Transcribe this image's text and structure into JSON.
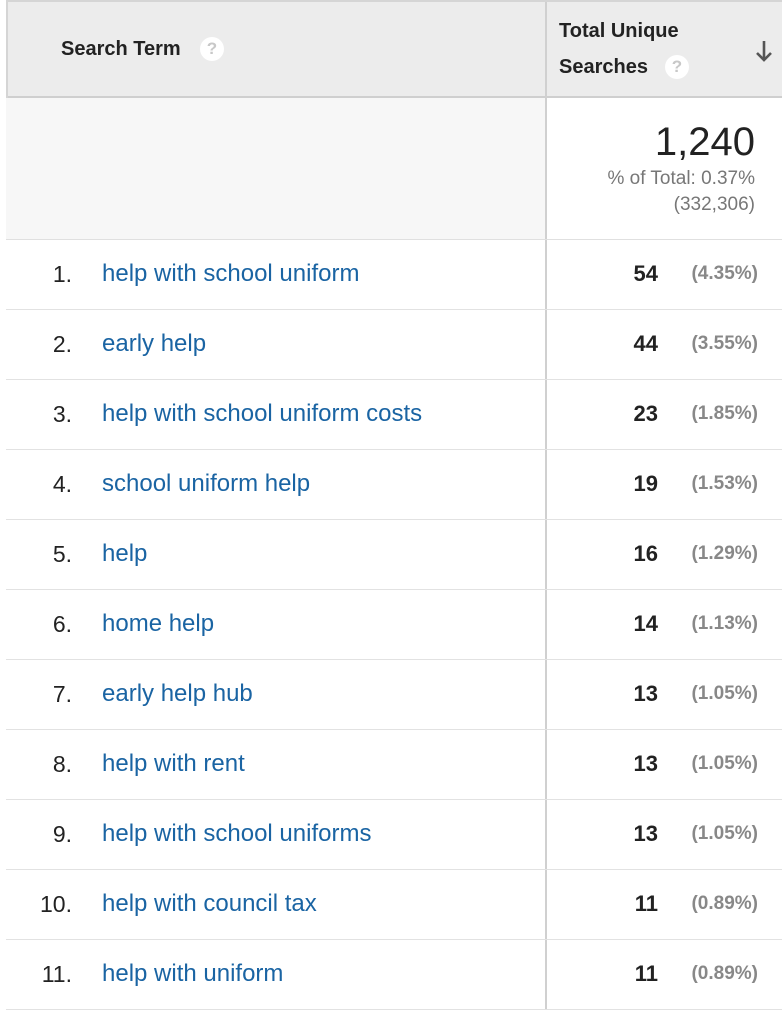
{
  "header": {
    "search_term": "Search Term",
    "metric_line1": "Total Unique",
    "metric_line2": "Searches",
    "help_glyph": "?",
    "sort_icon": "arrow-down-icon"
  },
  "summary": {
    "total": "1,240",
    "percent_of_total": "% of Total: 0.37%",
    "grand_total": "(332,306)"
  },
  "rows": [
    {
      "rank": "1.",
      "term": "help with school uniform",
      "value": "54",
      "pct": "(4.35%)"
    },
    {
      "rank": "2.",
      "term": "early help",
      "value": "44",
      "pct": "(3.55%)"
    },
    {
      "rank": "3.",
      "term": "help with school uniform costs",
      "value": "23",
      "pct": "(1.85%)"
    },
    {
      "rank": "4.",
      "term": "school uniform help",
      "value": "19",
      "pct": "(1.53%)"
    },
    {
      "rank": "5.",
      "term": "help",
      "value": "16",
      "pct": "(1.29%)"
    },
    {
      "rank": "6.",
      "term": "home help",
      "value": "14",
      "pct": "(1.13%)"
    },
    {
      "rank": "7.",
      "term": "early help hub",
      "value": "13",
      "pct": "(1.05%)"
    },
    {
      "rank": "8.",
      "term": "help with rent",
      "value": "13",
      "pct": "(1.05%)"
    },
    {
      "rank": "9.",
      "term": "help with school uniforms",
      "value": "13",
      "pct": "(1.05%)"
    },
    {
      "rank": "10.",
      "term": "help with council tax",
      "value": "11",
      "pct": "(0.89%)"
    },
    {
      "rank": "11.",
      "term": "help with uniform",
      "value": "11",
      "pct": "(0.89%)"
    }
  ],
  "colors": {
    "link": "#1a64a3",
    "header_bg": "#ececec",
    "summary_bg": "#f7f7f7"
  }
}
